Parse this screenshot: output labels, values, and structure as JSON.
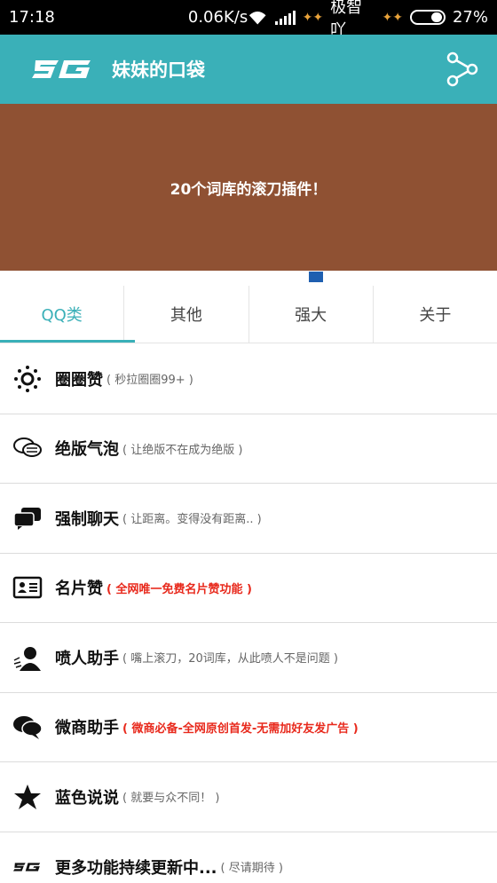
{
  "status_bar": {
    "time": "17:18",
    "speed": "0.06K/s",
    "carrier": "极智吖",
    "battery": "27%"
  },
  "app_bar": {
    "logo_text": "SG",
    "title": "妹妹的口袋",
    "share_icon": "share-icon"
  },
  "banner": {
    "text": "20个词库的滚刀插件！",
    "color": "#8f5133"
  },
  "tabs": [
    {
      "label": "QQ类",
      "active": true
    },
    {
      "label": "其他",
      "active": false
    },
    {
      "label": "强大",
      "active": false
    },
    {
      "label": "关于",
      "active": false
    }
  ],
  "items": [
    {
      "icon": "sun-icon",
      "title": "圈圈赞",
      "desc": "( 秒拉圈圈99+ )",
      "highlight": false
    },
    {
      "icon": "chat-bubbles-outline-icon",
      "title": "绝版气泡",
      "desc": "( 让绝版不在成为绝版 )",
      "highlight": false
    },
    {
      "icon": "chat-bubbles-solid-icon",
      "title": "强制聊天",
      "desc": "( 让距离。变得没有距离.. )",
      "highlight": false
    },
    {
      "icon": "business-card-icon",
      "title": "名片赞",
      "desc": "( 全网唯一免费名片赞功能 )",
      "highlight": true
    },
    {
      "icon": "person-speaking-icon",
      "title": "喷人助手",
      "desc": "( 嘴上滚刀，20词库，从此喷人不是问题 )",
      "highlight": false
    },
    {
      "icon": "chat-bubbles-icon",
      "title": "微商助手",
      "desc": "( 微商必备-全网原创首发-无需加好友发广告 )",
      "highlight": true
    },
    {
      "icon": "star-icon",
      "title": "蓝色说说",
      "desc": "( 就要与众不同！ )",
      "highlight": false
    },
    {
      "icon": "sg-logo-icon",
      "title": "更多功能持续更新中...",
      "desc": "( 尽请期待 )",
      "highlight": false
    }
  ],
  "colors": {
    "accent": "#3ab0b8",
    "highlight_text": "#e8291c",
    "indicator": "#1f5fb0"
  }
}
